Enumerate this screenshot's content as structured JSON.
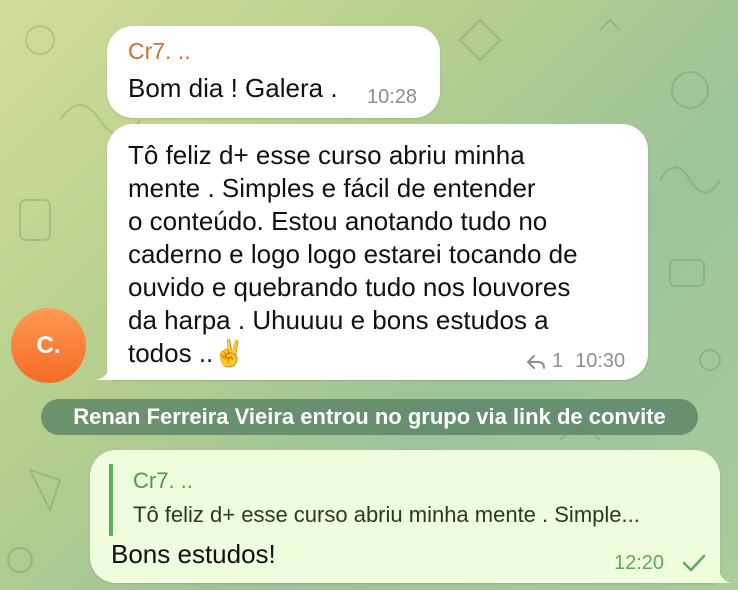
{
  "messages": [
    {
      "sender": "Cr7. ..",
      "text": "Bom dia ! Galera .",
      "time": "10:28"
    },
    {
      "lines": [
        "Tô feliz d+ esse curso abriu minha",
        "mente . Simples e fácil de entender",
        "o conteúdo. Estou anotando tudo no",
        "caderno e logo logo estarei tocando de",
        "ouvido e quebrando tudo nos louvores",
        "da harpa . Uhuuuu e bons estudos a",
        "todos ..✌️"
      ],
      "reply_count": "1",
      "time": "10:30",
      "reply_icon": "reply-arrow-icon"
    }
  ],
  "avatar": {
    "initials": "C.",
    "color": "#f47a35"
  },
  "service": {
    "text": "Renan Ferreira Vieira entrou no grupo via link de convite"
  },
  "outgoing": {
    "quote_name": "Cr7. ..",
    "quote_text": "Tô feliz d+ esse curso abriu minha mente . Simple...",
    "text": "Bons estudos!",
    "time": "12:20",
    "status_icon": "check-icon"
  },
  "colors": {
    "sender_name": "#cf6f2b",
    "outgoing_bubble": "#effdde",
    "quote_accent": "#5fb157",
    "outgoing_time": "#61a955"
  }
}
